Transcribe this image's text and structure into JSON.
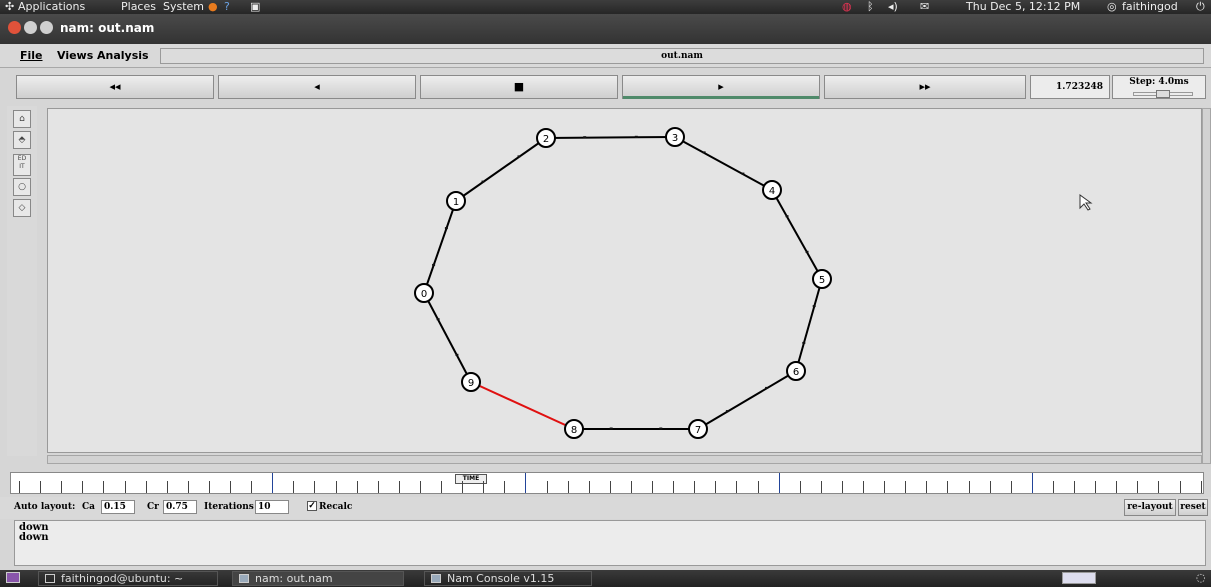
{
  "top_panel": {
    "menus": [
      "Applications",
      "Places",
      "System"
    ],
    "clock": "Thu Dec 5, 12:12 PM",
    "user": "faithingod"
  },
  "window": {
    "title": "nam: out.nam"
  },
  "menubar": {
    "items": [
      "File",
      "Views",
      "Analysis"
    ],
    "file_name": "out.nam"
  },
  "controls": {
    "rewind": "◂◂",
    "back": "◂",
    "stop": "■",
    "play": "▸",
    "forward": "▸▸",
    "time": "1.723248",
    "step": "Step: 4.0ms"
  },
  "tools": [
    "select-icon",
    "move-icon",
    "edit",
    "circle-icon",
    "diamond-icon"
  ],
  "tool_edit_label": "ED\nIT",
  "network": {
    "nodes": [
      "0",
      "1",
      "2",
      "3",
      "4",
      "5",
      "6",
      "7",
      "8",
      "9"
    ],
    "red_link": [
      "9",
      "8"
    ],
    "colors": {
      "link": "#000000",
      "highlight": "#e01010",
      "node_fill": "#ffffff"
    }
  },
  "timeline": {
    "marker": "TIME"
  },
  "layout": {
    "auto_label": "Auto layout:",
    "ca_label": "Ca",
    "ca_value": "0.15",
    "cr_label": "Cr",
    "cr_value": "0.75",
    "iter_label": "Iterations",
    "iter_value": "10",
    "recalc_label": "Recalc",
    "relayout": "re-layout",
    "reset": "reset"
  },
  "console": {
    "lines": [
      "down",
      "down"
    ]
  },
  "taskbar": {
    "items": [
      "faithingod@ubuntu: ~",
      "nam: out.nam",
      "Nam Console v1.15"
    ]
  }
}
